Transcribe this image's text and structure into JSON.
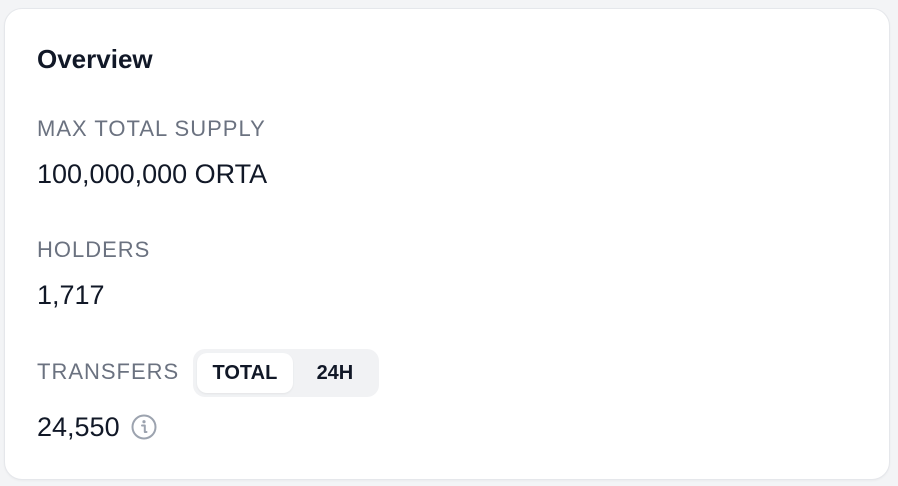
{
  "card": {
    "title": "Overview"
  },
  "supply": {
    "label": "MAX TOTAL SUPPLY",
    "value": "100,000,000 ORTA"
  },
  "holders": {
    "label": "HOLDERS",
    "value": "1,717"
  },
  "transfers": {
    "label": "TRANSFERS",
    "value": "24,550",
    "toggle": {
      "selected": "TOTAL",
      "options": [
        "TOTAL",
        "24H"
      ]
    },
    "info_icon": "info-icon"
  },
  "colors": {
    "card_bg": "#ffffff",
    "page_bg": "#f3f4f6",
    "border": "#e5e7eb",
    "label": "#6b7280",
    "text": "#111827",
    "toggle_bg": "#f1f2f4"
  }
}
